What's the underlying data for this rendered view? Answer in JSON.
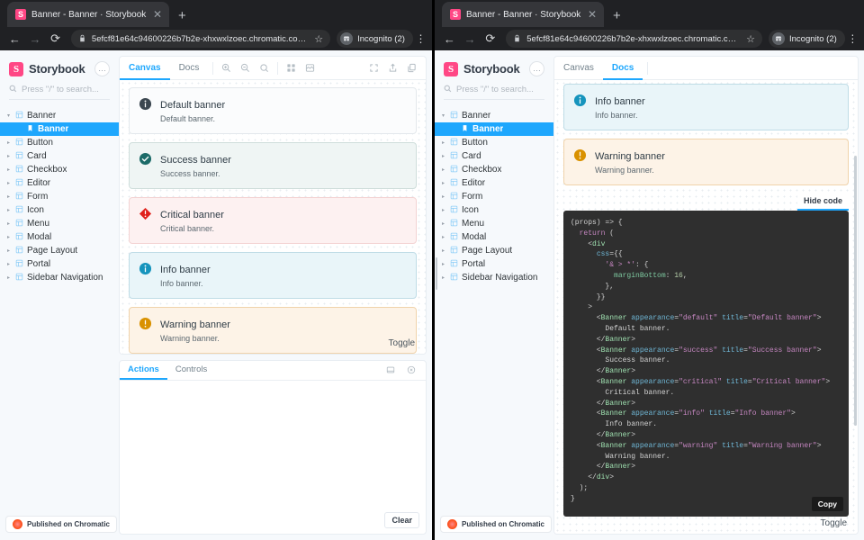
{
  "browser": {
    "tab_title": "Banner - Banner · Storybook",
    "favicon_letter": "S",
    "close_glyph": "✕",
    "newtab_glyph": "+",
    "back_glyph": "←",
    "forward_glyph": "→",
    "reload_glyph": "⟳",
    "lock_glyph": "🔒",
    "url_main": "5efcf81e64c94600226b7b2e-xhxwxlzoec.chromatic.com",
    "url_tail": "/?p…",
    "url_tail_right": "/?…",
    "star_glyph": "☆",
    "profile_label": "Incognito (2)",
    "menu_glyph": "⋮"
  },
  "sidebar": {
    "brand": "Storybook",
    "logo_letter": "S",
    "menu_label": "…",
    "search_placeholder": "Press \"/\" to search...",
    "search_icon": "search-icon",
    "items": [
      {
        "label": "Banner",
        "level": 0,
        "expanded": true,
        "selected": false
      },
      {
        "label": "Banner",
        "level": 1,
        "expanded": false,
        "selected": true
      },
      {
        "label": "Button",
        "level": 0,
        "expanded": false,
        "selected": false
      },
      {
        "label": "Card",
        "level": 0,
        "expanded": false,
        "selected": false
      },
      {
        "label": "Checkbox",
        "level": 0,
        "expanded": false,
        "selected": false
      },
      {
        "label": "Editor",
        "level": 0,
        "expanded": false,
        "selected": false
      },
      {
        "label": "Form",
        "level": 0,
        "expanded": false,
        "selected": false
      },
      {
        "label": "Icon",
        "level": 0,
        "expanded": false,
        "selected": false
      },
      {
        "label": "Menu",
        "level": 0,
        "expanded": false,
        "selected": false
      },
      {
        "label": "Modal",
        "level": 0,
        "expanded": false,
        "selected": false
      },
      {
        "label": "Page Layout",
        "level": 0,
        "expanded": false,
        "selected": false
      },
      {
        "label": "Portal",
        "level": 0,
        "expanded": false,
        "selected": false
      },
      {
        "label": "Sidebar Navigation",
        "level": 0,
        "expanded": false,
        "selected": false
      }
    ],
    "footer_badge": "Published on Chromatic"
  },
  "left_pane": {
    "tabs": [
      {
        "label": "Canvas",
        "active": true
      },
      {
        "label": "Docs",
        "active": false
      }
    ],
    "toolbar_icons": [
      "zoom-in-icon",
      "zoom-out-icon",
      "zoom-reset-icon",
      "grid-icon",
      "background-icon",
      "fullscreen-icon",
      "share-icon",
      "copy-link-icon"
    ],
    "toggle_label": "Toggle",
    "addon_tabs": [
      {
        "label": "Actions",
        "active": true
      },
      {
        "label": "Controls",
        "active": false
      }
    ],
    "addon_icons": [
      "dock-bottom-icon",
      "close-addon-icon"
    ],
    "clear_label": "Clear"
  },
  "right_pane": {
    "tabs": [
      {
        "label": "Canvas",
        "active": false
      },
      {
        "label": "Docs",
        "active": true
      }
    ],
    "hide_code_label": "Hide code",
    "copy_label": "Copy",
    "toggle_label": "Toggle"
  },
  "banners": [
    {
      "appearance": "default",
      "title": "Default banner",
      "description": "Default banner.",
      "icon": "info-circle-icon",
      "bg": "#fbfcfd",
      "border": "#e3e8ec",
      "icon_color": "#3c4750"
    },
    {
      "appearance": "success",
      "title": "Success banner",
      "description": "Success banner.",
      "icon": "check-circle-icon",
      "bg": "#eff5f4",
      "border": "#cfdedb",
      "icon_color": "#1c6b68"
    },
    {
      "appearance": "critical",
      "title": "Critical banner",
      "description": "Critical banner.",
      "icon": "critical-diamond-icon",
      "bg": "#fdf1f1",
      "border": "#f3d3d3",
      "icon_color": "#e0211b"
    },
    {
      "appearance": "info",
      "title": "Info banner",
      "description": "Info banner.",
      "icon": "info-circle-icon",
      "bg": "#e9f5f9",
      "border": "#bfdce6",
      "icon_color": "#1694bd"
    },
    {
      "appearance": "warning",
      "title": "Warning banner",
      "description": "Warning banner.",
      "icon": "warning-circle-icon",
      "bg": "#fdf3e7",
      "border": "#f0d3ab",
      "icon_color": "#d99100"
    }
  ],
  "docs_banners": [
    {
      "appearance": "info",
      "title": "Info banner",
      "description": "Info banner.",
      "icon": "info-circle-icon",
      "bg": "#e9f5f9",
      "border": "#bfdce6",
      "icon_color": "#1694bd"
    },
    {
      "appearance": "warning",
      "title": "Warning banner",
      "description": "Warning banner.",
      "icon": "warning-circle-icon",
      "bg": "#fdf3e7",
      "border": "#f0d3ab",
      "icon_color": "#d99100"
    }
  ],
  "code": {
    "lines": [
      [
        [
          "punc",
          "(props) => {"
        ]
      ],
      [
        [
          "punc",
          "  "
        ],
        [
          "kw",
          "return"
        ],
        [
          "punc",
          " ("
        ]
      ],
      [
        [
          "punc",
          "    <"
        ],
        [
          "tag",
          "div"
        ]
      ],
      [
        [
          "punc",
          "      "
        ],
        [
          "attr",
          "css"
        ],
        [
          "punc",
          "={{"
        ]
      ],
      [
        [
          "punc",
          "        "
        ],
        [
          "str",
          "'& > *'"
        ],
        [
          "punc",
          ": {"
        ]
      ],
      [
        [
          "punc",
          "          "
        ],
        [
          "prop",
          "marginBottom"
        ],
        [
          "punc",
          ": "
        ],
        [
          "num",
          "16"
        ],
        [
          "punc",
          ","
        ]
      ],
      [
        [
          "punc",
          "        },"
        ]
      ],
      [
        [
          "punc",
          "      }}"
        ]
      ],
      [
        [
          "punc",
          "    >"
        ]
      ],
      [
        [
          "punc",
          "      <"
        ],
        [
          "tag",
          "Banner"
        ],
        [
          "punc",
          " "
        ],
        [
          "attr",
          "appearance"
        ],
        [
          "punc",
          "="
        ],
        [
          "str",
          "\"default\""
        ],
        [
          "punc",
          " "
        ],
        [
          "attr",
          "title"
        ],
        [
          "punc",
          "="
        ],
        [
          "str",
          "\"Default banner\""
        ],
        [
          "punc",
          ">"
        ]
      ],
      [
        [
          "txt",
          "        Default banner."
        ]
      ],
      [
        [
          "punc",
          "      </"
        ],
        [
          "tag",
          "Banner"
        ],
        [
          "punc",
          ">"
        ]
      ],
      [
        [
          "punc",
          "      <"
        ],
        [
          "tag",
          "Banner"
        ],
        [
          "punc",
          " "
        ],
        [
          "attr",
          "appearance"
        ],
        [
          "punc",
          "="
        ],
        [
          "str",
          "\"success\""
        ],
        [
          "punc",
          " "
        ],
        [
          "attr",
          "title"
        ],
        [
          "punc",
          "="
        ],
        [
          "str",
          "\"Success banner\""
        ],
        [
          "punc",
          ">"
        ]
      ],
      [
        [
          "txt",
          "        Success banner."
        ]
      ],
      [
        [
          "punc",
          "      </"
        ],
        [
          "tag",
          "Banner"
        ],
        [
          "punc",
          ">"
        ]
      ],
      [
        [
          "punc",
          "      <"
        ],
        [
          "tag",
          "Banner"
        ],
        [
          "punc",
          " "
        ],
        [
          "attr",
          "appearance"
        ],
        [
          "punc",
          "="
        ],
        [
          "str",
          "\"critical\""
        ],
        [
          "punc",
          " "
        ],
        [
          "attr",
          "title"
        ],
        [
          "punc",
          "="
        ],
        [
          "str",
          "\"Critical banner\""
        ],
        [
          "punc",
          ">"
        ]
      ],
      [
        [
          "txt",
          "        Critical banner."
        ]
      ],
      [
        [
          "punc",
          "      </"
        ],
        [
          "tag",
          "Banner"
        ],
        [
          "punc",
          ">"
        ]
      ],
      [
        [
          "punc",
          "      <"
        ],
        [
          "tag",
          "Banner"
        ],
        [
          "punc",
          " "
        ],
        [
          "attr",
          "appearance"
        ],
        [
          "punc",
          "="
        ],
        [
          "str",
          "\"info\""
        ],
        [
          "punc",
          " "
        ],
        [
          "attr",
          "title"
        ],
        [
          "punc",
          "="
        ],
        [
          "str",
          "\"Info banner\""
        ],
        [
          "punc",
          ">"
        ]
      ],
      [
        [
          "txt",
          "        Info banner."
        ]
      ],
      [
        [
          "punc",
          "      </"
        ],
        [
          "tag",
          "Banner"
        ],
        [
          "punc",
          ">"
        ]
      ],
      [
        [
          "punc",
          "      <"
        ],
        [
          "tag",
          "Banner"
        ],
        [
          "punc",
          " "
        ],
        [
          "attr",
          "appearance"
        ],
        [
          "punc",
          "="
        ],
        [
          "str",
          "\"warning\""
        ],
        [
          "punc",
          " "
        ],
        [
          "attr",
          "title"
        ],
        [
          "punc",
          "="
        ],
        [
          "str",
          "\"Warning banner\""
        ],
        [
          "punc",
          ">"
        ]
      ],
      [
        [
          "txt",
          "        Warning banner."
        ]
      ],
      [
        [
          "punc",
          "      </"
        ],
        [
          "tag",
          "Banner"
        ],
        [
          "punc",
          ">"
        ]
      ],
      [
        [
          "punc",
          "    </"
        ],
        [
          "tag",
          "div"
        ],
        [
          "punc",
          ">"
        ]
      ],
      [
        [
          "punc",
          "  );"
        ]
      ],
      [
        [
          "punc",
          "}"
        ]
      ]
    ]
  },
  "colors": {
    "accent": "#1ea7fd",
    "brand_pink": "#ff4785",
    "chrome_bg": "#202124",
    "app_bg": "#f6f9fc",
    "code_bg": "#2f2f2f"
  }
}
